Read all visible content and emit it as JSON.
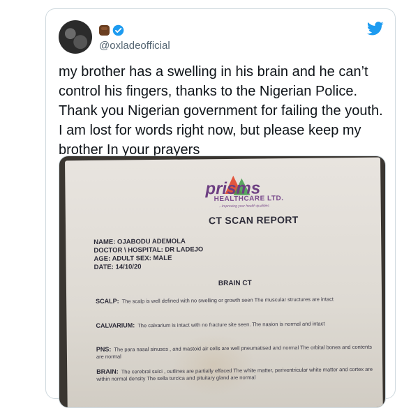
{
  "tweet": {
    "handle": "@oxladeofficial",
    "text": "my brother has a swelling in his brain and he can’t control his fingers, thanks to the Nigerian Police. Thank you Nigerian government for failing the youth. I am lost for words right now, but please keep my brother In your prayers"
  },
  "icons": {
    "avatar": "user-avatar",
    "emoji": "raised-fist-icon",
    "verified": "verified-badge-icon",
    "logo": "twitter-bird-icon"
  },
  "colors": {
    "twitter_blue": "#1d9bf0",
    "handle_gray": "#536471",
    "text": "#0f1419"
  },
  "document": {
    "logo_text": "prisms",
    "company": "HEALTHCARE LTD.",
    "tagline": "...Improving your health qualities",
    "title": "CT SCAN REPORT",
    "meta_lines": [
      "NAME: OJABODU ADEMOLA",
      "DOCTOR \\ HOSPITAL: DR LADEJO",
      "AGE: ADULT SEX: MALE",
      "DATE: 14/10/20"
    ],
    "section_title": "BRAIN CT",
    "sections": [
      {
        "label": "SCALP:",
        "text": "The scalp is well defined with no swelling or growth seen The muscular structures are intact"
      },
      {
        "label": "CALVARIUM:",
        "text": "The calvarium is intact with no fracture site seen. The nasion is normal and intact"
      },
      {
        "label": "PNS:",
        "text": "The para nasal sinuses , and mastoid air cells are well pneumatised and normal The orbital bones and contents are normal"
      },
      {
        "label": "BRAIN:",
        "text": "The cerebral sulci , outlines are partially effaced The white matter, periventricular white matter and cortex are within normal density The sella turcica and pituitary gland are normal"
      }
    ]
  }
}
